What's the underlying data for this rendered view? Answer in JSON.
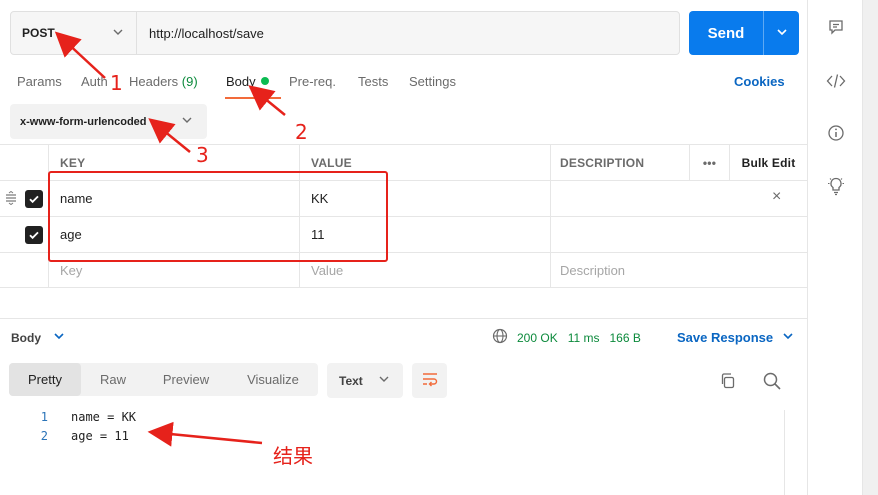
{
  "request": {
    "method": "POST",
    "url": "http://localhost/save",
    "send_label": "Send"
  },
  "tabs": [
    {
      "label": "Params"
    },
    {
      "label": "Auth"
    },
    {
      "label": "Headers",
      "count": "(9)"
    },
    {
      "label": "Body",
      "active": true
    },
    {
      "label": "Pre-req."
    },
    {
      "label": "Tests"
    },
    {
      "label": "Settings"
    }
  ],
  "cookies_label": "Cookies",
  "body_type": "x-www-form-urlencoded",
  "table": {
    "headers": {
      "key": "KEY",
      "value": "VALUE",
      "description": "DESCRIPTION",
      "more": "•••",
      "bulk_edit": "Bulk Edit"
    },
    "rows": [
      {
        "key": "name",
        "value": "KK",
        "checked": true
      },
      {
        "key": "age",
        "value": "11",
        "checked": true
      }
    ],
    "placeholder": {
      "key": "Key",
      "value": "Value",
      "description": "Description"
    }
  },
  "response": {
    "title": "Body",
    "status": "200 OK",
    "time": "11 ms",
    "size": "166 B",
    "save_label": "Save Response",
    "view_tabs": [
      "Pretty",
      "Raw",
      "Preview",
      "Visualize"
    ],
    "active_view": "Pretty",
    "format": "Text",
    "lines": [
      {
        "num": "1",
        "text": "name = KK"
      },
      {
        "num": "2",
        "text": "age = 11"
      }
    ]
  },
  "annotations": {
    "n1": "1",
    "n2": "2",
    "n3": "3",
    "result": "结果"
  },
  "colors": {
    "accent": "#097bed",
    "annotation": "#e6221b",
    "success": "#0c8a3c",
    "tab_underline": "#f26b3a"
  }
}
